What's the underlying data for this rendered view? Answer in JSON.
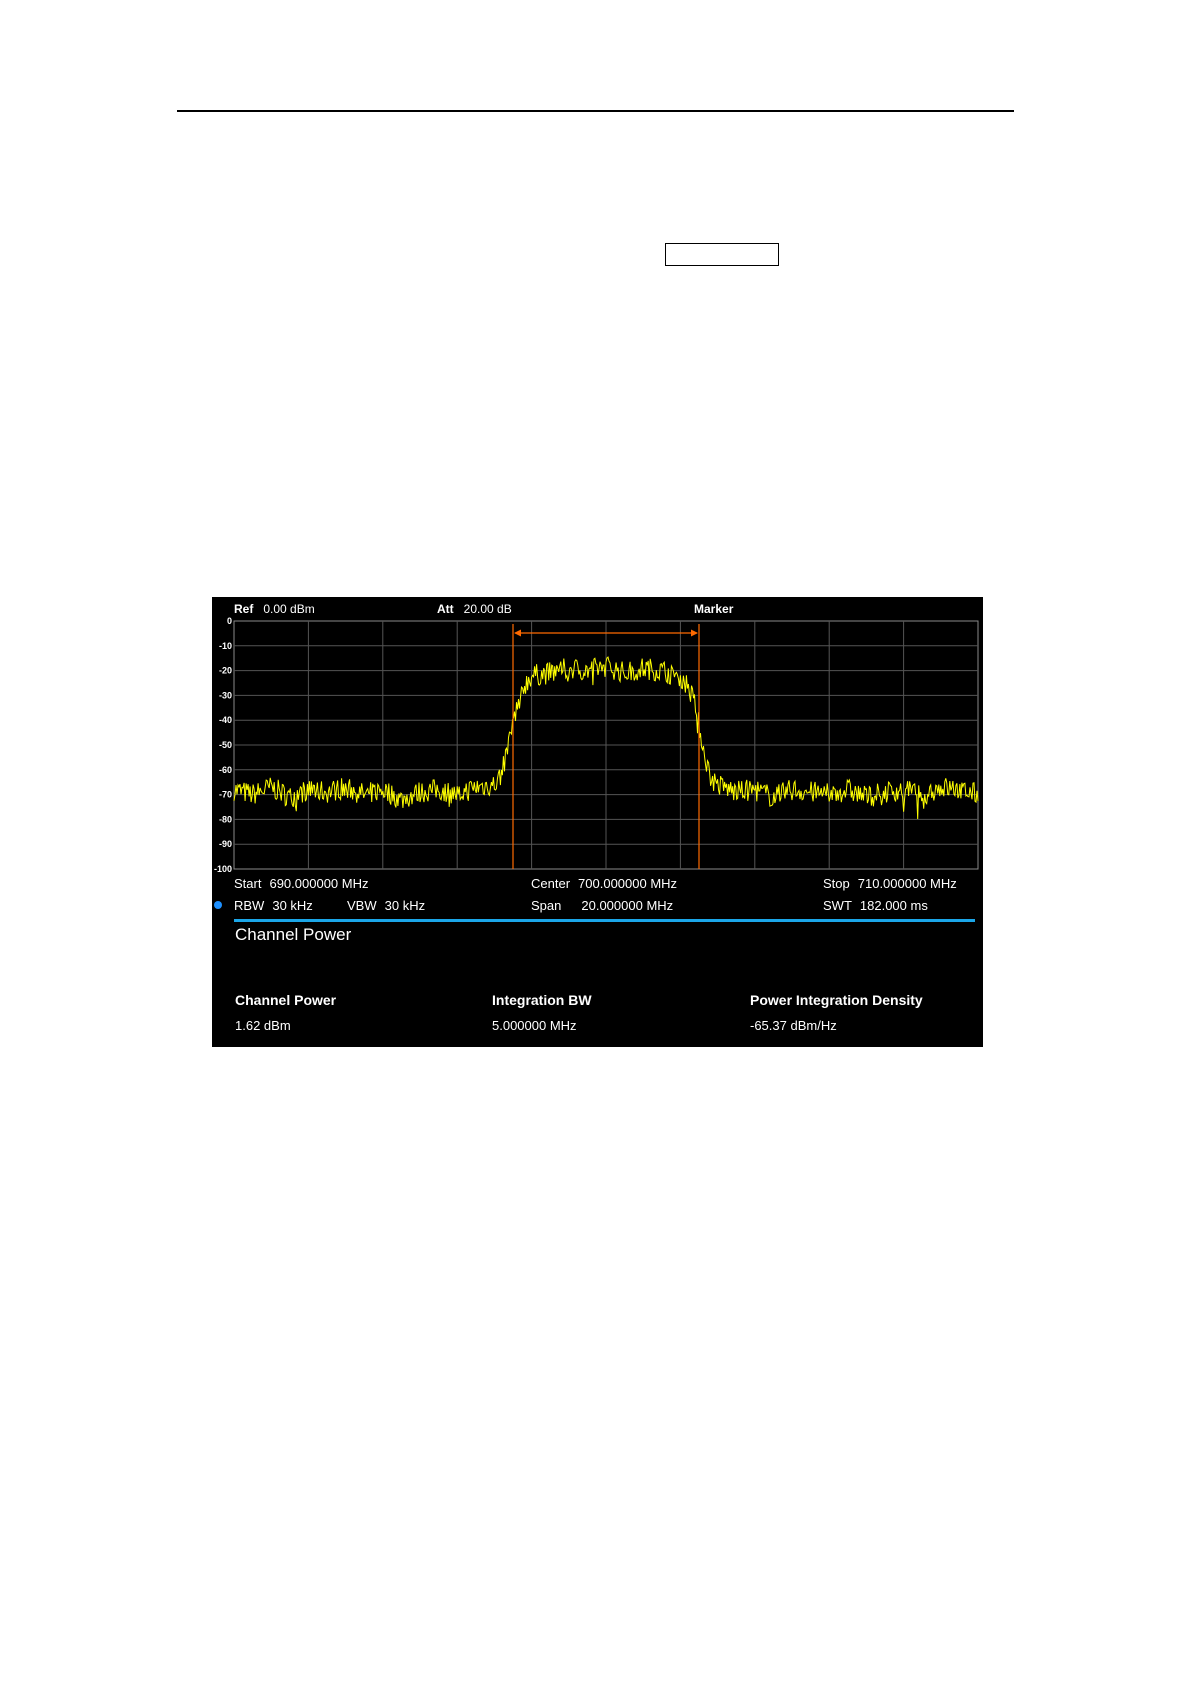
{
  "header": {
    "ref_label": "Ref",
    "ref_value": "0.00 dBm",
    "att_label": "Att",
    "att_value": "20.00 dB",
    "marker_label": "Marker"
  },
  "chart_data": {
    "type": "line",
    "xlim": [
      690,
      710
    ],
    "ylim": [
      -100,
      0
    ],
    "y_ticks": [
      "0",
      "-10",
      "-20",
      "-30",
      "-40",
      "-50",
      "-60",
      "-70",
      "-80",
      "-90",
      "-100"
    ],
    "grid": true,
    "channel_edges_mhz": [
      697.5,
      702.5
    ],
    "series": [
      {
        "color": "#ffff00",
        "x": [
          690.0,
          690.5,
          691.0,
          691.5,
          692.0,
          692.5,
          693.0,
          693.5,
          694.0,
          694.5,
          695.0,
          695.5,
          696.0,
          696.5,
          697.0,
          697.2,
          697.4,
          697.6,
          697.8,
          698.0,
          698.5,
          699.0,
          699.5,
          700.0,
          700.5,
          701.0,
          701.5,
          702.0,
          702.2,
          702.4,
          702.6,
          702.8,
          703.0,
          703.5,
          704.0,
          704.5,
          705.0,
          705.5,
          706.0,
          706.5,
          707.0,
          707.5,
          708.0,
          708.5,
          709.0,
          709.5,
          710.0
        ],
        "y": [
          -68,
          -70,
          -67,
          -71,
          -68,
          -69,
          -67,
          -70,
          -68,
          -72,
          -69,
          -68,
          -70,
          -67,
          -66,
          -62,
          -48,
          -34,
          -26,
          -22,
          -21,
          -19,
          -20,
          -18,
          -21,
          -19,
          -20,
          -22,
          -26,
          -34,
          -50,
          -63,
          -66,
          -69,
          -68,
          -71,
          -68,
          -69,
          -70,
          -68,
          -71,
          -69,
          -68,
          -70,
          -67,
          -68,
          -70
        ]
      }
    ]
  },
  "footer": {
    "start_label": "Start",
    "start_value": "690.000000 MHz",
    "center_label": "Center",
    "center_value": "700.000000 MHz",
    "stop_label": "Stop",
    "stop_value": "710.000000 MHz",
    "rbw_label": "RBW",
    "rbw_value": "30 kHz",
    "vbw_label": "VBW",
    "vbw_value": "30 kHz",
    "span_label": "Span",
    "span_value": "20.000000 MHz",
    "swt_label": "SWT",
    "swt_value": "182.000 ms"
  },
  "result": {
    "title": "Channel Power",
    "columns": [
      {
        "label": "Channel Power",
        "value": "1.62 dBm"
      },
      {
        "label": "Integration BW",
        "value": "5.000000 MHz"
      },
      {
        "label": "Power Integration Density",
        "value": "-65.37 dBm/Hz"
      }
    ]
  },
  "colors": {
    "trace": "#ffff00",
    "channel_marker": "#ff6a00",
    "accent_rule": "#1ba6e8",
    "grid": "#555555"
  }
}
